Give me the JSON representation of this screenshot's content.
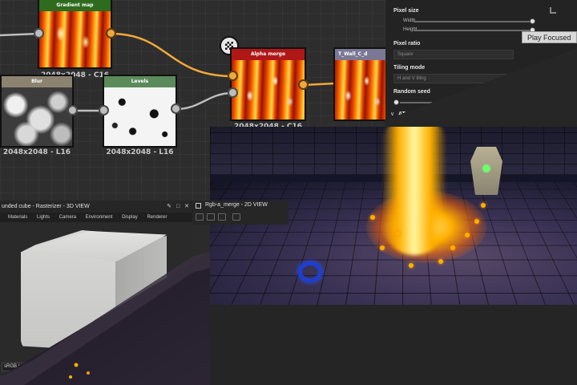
{
  "graph": {
    "nodes": {
      "gradient_map": {
        "title": "Gradient map",
        "size": "2048x2048 - C16",
        "header_color": "#2f6b1e"
      },
      "blur": {
        "title": "Blur",
        "size": "2048x2048 - L16",
        "header_color": "#8b8270"
      },
      "levels": {
        "title": "Levels",
        "size": "2048x2048 - L16",
        "header_color": "#5b8a5b"
      },
      "alpha_merge": {
        "title": "Alpha merge",
        "size": "2048x2048 - C16",
        "header_color": "#b01818"
      },
      "output": {
        "title": "T_Wall_C_d",
        "size": "",
        "header_color": "#7a7894"
      }
    }
  },
  "properties": {
    "pixel_size": {
      "label": "Pixel size",
      "width_label": "Width",
      "height_label": "Height",
      "width_value": 1.0,
      "height_value": 1.0
    },
    "pixel_ratio": {
      "label": "Pixel ratio",
      "value": "Square"
    },
    "tiling_mode": {
      "label": "Tiling mode",
      "value": "H and V tiling"
    },
    "random_seed": {
      "label": "Random seed",
      "value": 0.0
    },
    "attributes_label": "AT"
  },
  "tooltip": "Play Focused",
  "view3d": {
    "title": "unded cube - Rasterizer - 3D VIEW",
    "menu": [
      "Materials",
      "Lights",
      "Camera",
      "Environment",
      "Display",
      "Renderer"
    ],
    "colorspace": "sRGB (d"
  },
  "view2d": {
    "title": "Rgb-a_merge - 2D VIEW"
  }
}
